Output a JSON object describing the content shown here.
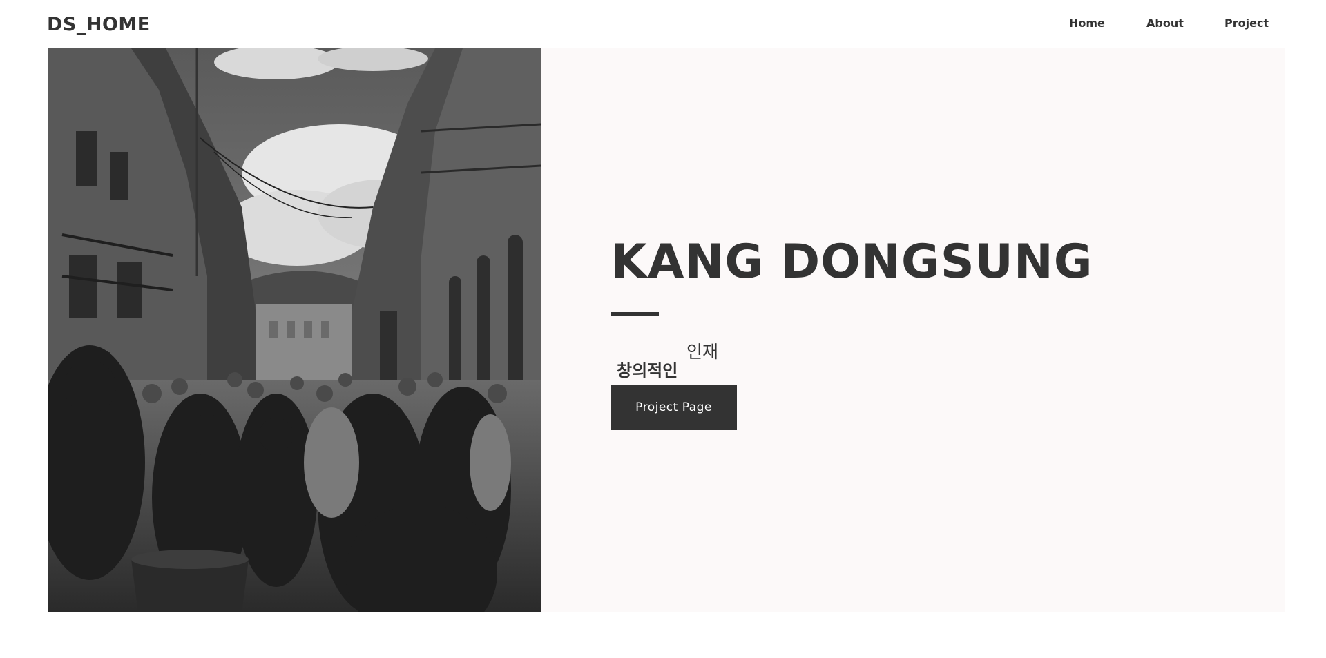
{
  "header": {
    "logo": "DS_HOME",
    "nav": [
      {
        "label": "Home"
      },
      {
        "label": "About"
      },
      {
        "label": "Project"
      }
    ]
  },
  "hero": {
    "image_description_icon": "street-photo",
    "title": "KANG DONGSUNG",
    "tagline": {
      "strong": "창의적인",
      "sup": "인재"
    },
    "cta_label": "Project Page"
  },
  "colors": {
    "text": "#333333",
    "hero_bg": "#fcf9f9",
    "button_bg": "#333333",
    "button_text": "#ffffff"
  }
}
